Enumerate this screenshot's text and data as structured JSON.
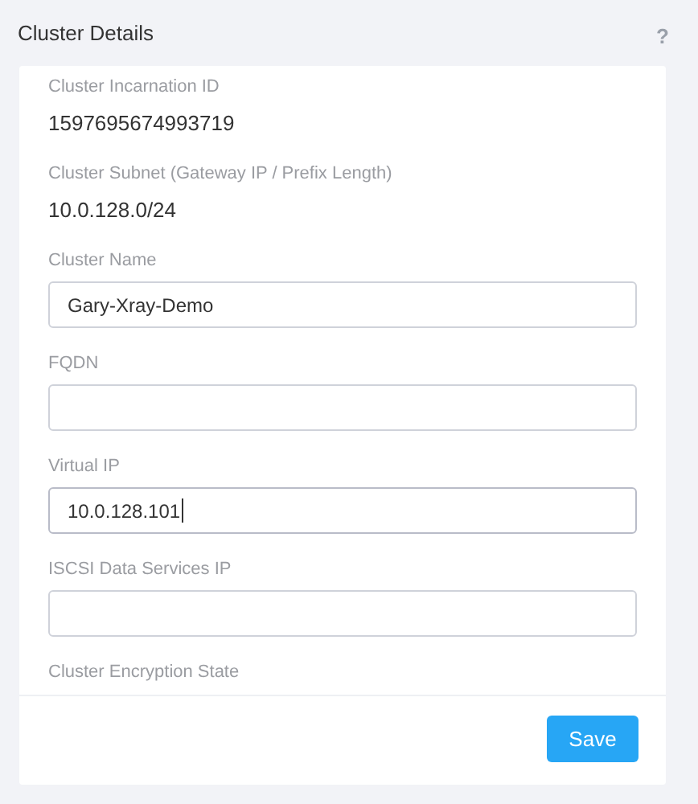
{
  "title": "Cluster Details",
  "help": "?",
  "fields": [
    {
      "kind": "text",
      "label": "Cluster Incarnation ID",
      "value": "1597695674993719"
    },
    {
      "kind": "text",
      "label": "Cluster Subnet (Gateway IP / Prefix Length)",
      "value": "10.0.128.0/24"
    },
    {
      "kind": "input",
      "label": "Cluster Name",
      "value": "Gary-Xray-Demo",
      "focused": false
    },
    {
      "kind": "input",
      "label": "FQDN",
      "focused": false
    },
    {
      "kind": "input",
      "label": "Virtual IP",
      "value": "10.0.128.101",
      "focused": true
    },
    {
      "kind": "input",
      "label": "ISCSI Data Services IP",
      "focused": false
    },
    {
      "kind": "heading",
      "label": "Cluster Encryption State"
    }
  ],
  "save_button": "Save"
}
